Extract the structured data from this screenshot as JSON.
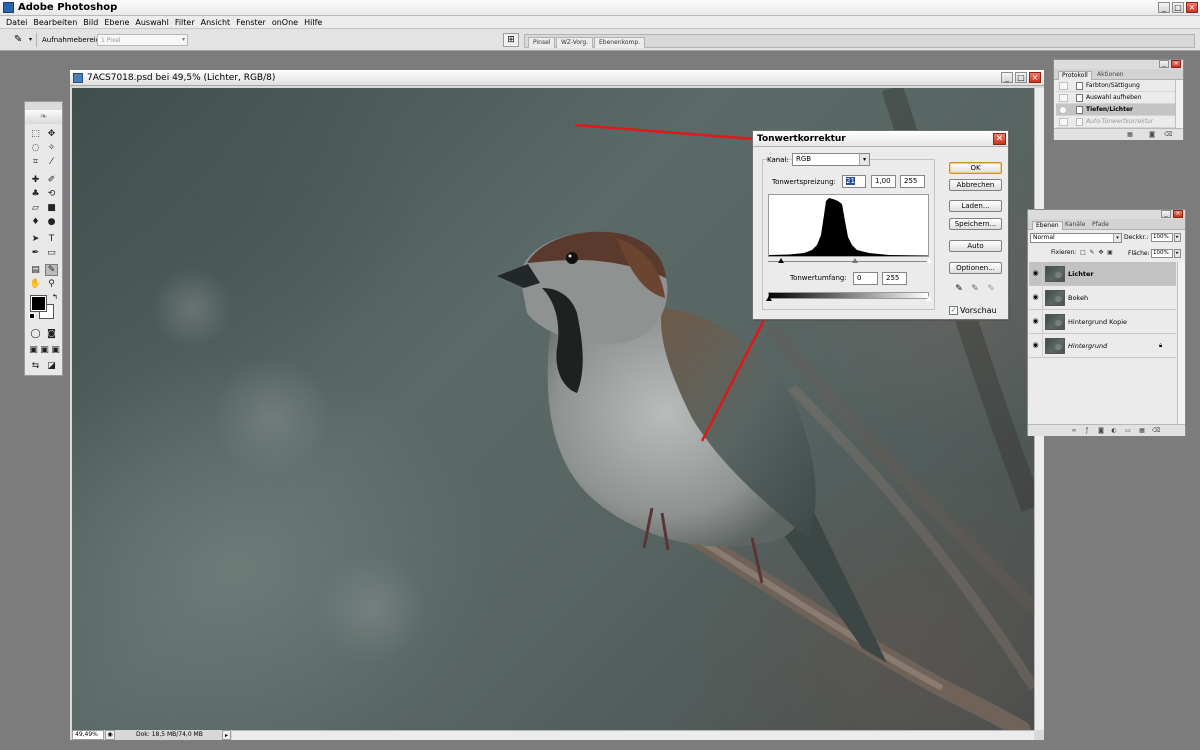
{
  "app": {
    "title": "Adobe Photoshop",
    "window_controls": [
      "_",
      "□",
      "×"
    ]
  },
  "menu": [
    "Datei",
    "Bearbeiten",
    "Bild",
    "Ebene",
    "Auswahl",
    "Filter",
    "Ansicht",
    "Fenster",
    "onOne",
    "Hilfe"
  ],
  "options_bar": {
    "sample_label": "Aufnahmebereich:",
    "sample_value": "1 Pixel",
    "palette_well_tabs": [
      "Pinsel",
      "WZ-Vorg.",
      "Ebenenkomp."
    ]
  },
  "document": {
    "title": "7ACS7018.psd bei 49,5% (Lichter, RGB/8)",
    "zoom": "49,49%",
    "doc_size": "Dok: 18,5 MB/74,0 MB"
  },
  "levels": {
    "title": "Tonwertkorrektur",
    "channel_label": "Kanal:",
    "channel_value": "RGB",
    "input_label": "Tonwertspreizung:",
    "input_values": [
      "21",
      "1,00",
      "255"
    ],
    "output_label": "Tonwertumfang:",
    "output_values": [
      "0",
      "255"
    ],
    "buttons": [
      "OK",
      "Abbrechen",
      "Laden...",
      "Speichern...",
      "Auto",
      "Optionen..."
    ],
    "preview_label": "Vorschau",
    "preview_checked": true,
    "input_black_point": 21,
    "input_gamma": 1.0,
    "input_white_point": 255
  },
  "history": {
    "tabs": [
      "Protokoll",
      "Aktionen"
    ],
    "items": [
      {
        "label": "Farbton/Sättigung",
        "state": "normal"
      },
      {
        "label": "Auswahl aufheben",
        "state": "normal"
      },
      {
        "label": "Tiefen/Lichter",
        "state": "active"
      },
      {
        "label": "Auto-Tonwertkorrektur",
        "state": "ghost"
      }
    ]
  },
  "layers": {
    "tabs": [
      "Ebenen",
      "Kanäle",
      "Pfade"
    ],
    "blend_mode": "Normal",
    "opacity_label": "Deckkr.:",
    "opacity_value": "100%",
    "lock_label": "Fixieren:",
    "fill_label": "Fläche:",
    "fill_value": "100%",
    "items": [
      {
        "name": "Lichter",
        "active": true,
        "locked": false
      },
      {
        "name": "Bokeh",
        "active": false,
        "locked": false
      },
      {
        "name": "Hintergrund Kopie",
        "active": false,
        "locked": false
      },
      {
        "name": "Hintergrund",
        "active": false,
        "locked": true
      }
    ]
  },
  "colors": {
    "annotation_arrow": "#e01818",
    "foreground": "#000000",
    "background": "#ffffff"
  }
}
